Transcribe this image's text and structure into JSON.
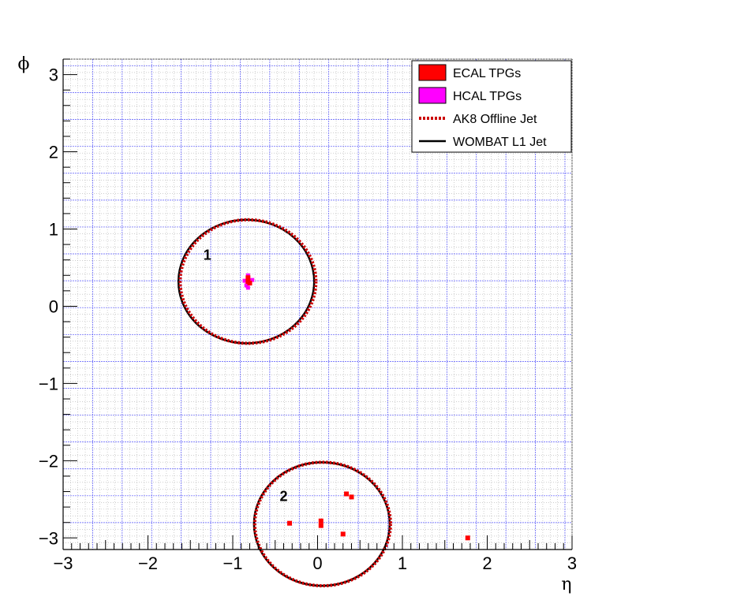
{
  "chart_data": {
    "type": "scatter",
    "xlabel": "η",
    "ylabel": "ϕ",
    "xlim": [
      -3,
      3
    ],
    "ylim": [
      -3.15,
      3.2
    ],
    "x_ticks": [
      -3,
      -2,
      -1,
      0,
      1,
      2,
      3
    ],
    "y_ticks": [
      -3,
      -2,
      -1,
      0,
      1,
      2,
      3
    ],
    "grid": true,
    "legend_position": "top-right",
    "legend": [
      {
        "key": "ecal",
        "label": "ECAL TPGs",
        "style": "box",
        "fill": "#ff0000"
      },
      {
        "key": "hcal",
        "label": "HCAL TPGs",
        "style": "box",
        "fill": "#ff00ff"
      },
      {
        "key": "ak8",
        "label": "AK8 Offline Jet",
        "style": "dotted",
        "color": "#cc0000"
      },
      {
        "key": "wombat",
        "label": "WOMBAT L1 Jet",
        "style": "solid",
        "color": "#000000"
      }
    ],
    "jets": [
      {
        "label": "1",
        "label_x": -1.3,
        "label_y": 0.6,
        "offline": {
          "eta": -0.82,
          "phi": 0.32,
          "radius": 0.8
        },
        "l1": {
          "eta": -0.84,
          "phi": 0.32,
          "radius": 0.8
        }
      },
      {
        "label": "2",
        "label_x": -0.4,
        "label_y": -2.52,
        "offline": {
          "eta": 0.06,
          "phi": -2.82,
          "radius": 0.8
        },
        "l1": {
          "eta": 0.05,
          "phi": -2.82,
          "radius": 0.8
        }
      }
    ],
    "ecal_tpgs": [
      {
        "eta": -0.82,
        "phi": 0.32
      },
      {
        "eta": -0.82,
        "phi": 0.37
      },
      {
        "eta": -0.8,
        "phi": 0.3
      },
      {
        "eta": 0.04,
        "phi": -2.78
      },
      {
        "eta": 0.04,
        "phi": -2.84
      },
      {
        "eta": 0.4,
        "phi": -2.47
      },
      {
        "eta": -0.33,
        "phi": -2.81
      },
      {
        "eta": 0.34,
        "phi": -2.43
      },
      {
        "eta": 1.77,
        "phi": -3.0
      },
      {
        "eta": 0.3,
        "phi": -2.95
      }
    ],
    "hcal_tpgs": [
      {
        "eta": -0.82,
        "phi": 0.4
      },
      {
        "eta": -0.86,
        "phi": 0.33
      },
      {
        "eta": -0.84,
        "phi": 0.27
      },
      {
        "eta": -0.77,
        "phi": 0.34
      },
      {
        "eta": -0.82,
        "phi": 0.24
      }
    ]
  },
  "colors": {
    "ecal": "#ff0000",
    "hcal": "#ff00ff",
    "ak8": "#cc0000",
    "wombat": "#000000",
    "grid": "#5a5aff",
    "minor_grid": "#b0b0b0"
  }
}
